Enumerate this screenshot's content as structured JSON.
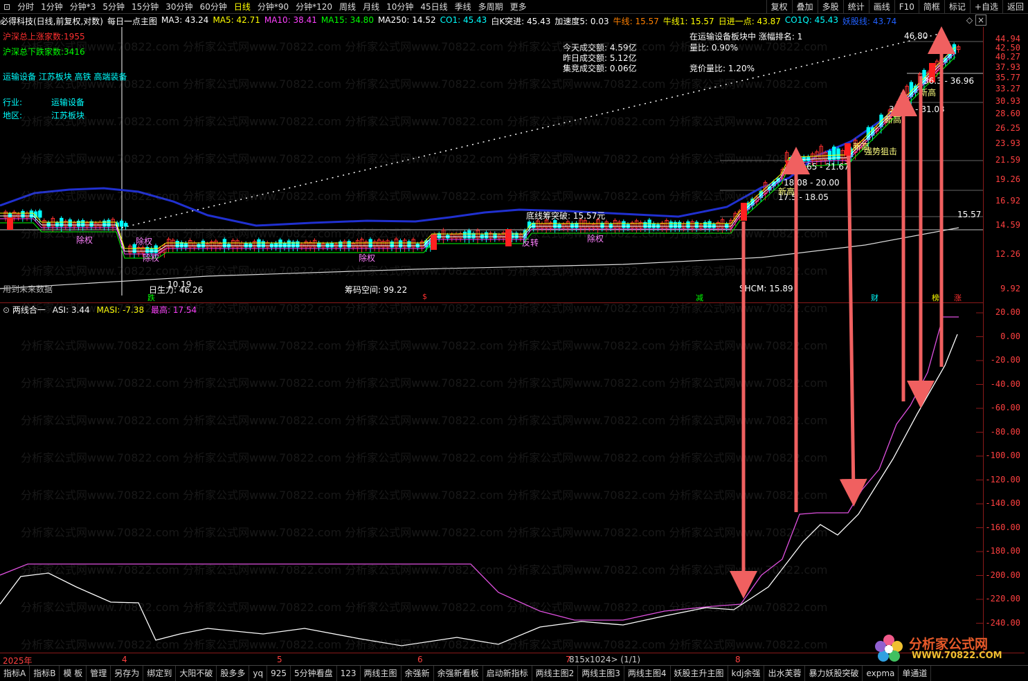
{
  "top_nav": {
    "periods": [
      "分时",
      "1分钟",
      "分钟*3",
      "5分钟",
      "15分钟",
      "30分钟",
      "60分钟",
      "日线",
      "分钟*90",
      "分钟*120",
      "周线",
      "月线",
      "10分钟",
      "45日线",
      "季线",
      "多周期",
      "更多"
    ],
    "active": "日线",
    "right_buttons": [
      "复权",
      "叠加",
      "多股",
      "统计",
      "画线",
      "F10",
      "简框",
      "标记",
      "+自选",
      "返回"
    ]
  },
  "stock": {
    "title": "必得科技(日线,前复权,对数)",
    "indicator_name": "每日一点主图",
    "ma_items": [
      {
        "label": "MA3: 43.24",
        "color": "#ffffff"
      },
      {
        "label": "MA5: 42.71",
        "color": "#ffff00"
      },
      {
        "label": "MA10: 38.41",
        "color": "#ff40ff"
      },
      {
        "label": "MA15: 34.80",
        "color": "#00ff00"
      },
      {
        "label": "MA250: 14.52",
        "color": "#ffffff"
      },
      {
        "label": "CO1: 45.43",
        "color": "#00ffff"
      },
      {
        "label": "白K突进: 45.43",
        "color": "#ffffff"
      },
      {
        "label": "加速度5: 0.03",
        "color": "#ffffff"
      },
      {
        "label": "牛线: 15.57",
        "color": "#ff8000"
      },
      {
        "label": "牛线1: 15.57",
        "color": "#ffff00"
      },
      {
        "label": "日进一点: 43.87",
        "color": "#ffff00"
      },
      {
        "label": "CO1Q: 45.43",
        "color": "#00ffff"
      },
      {
        "label": "妖股线: 43.74",
        "color": "#2060ff"
      }
    ]
  },
  "left_info": {
    "up_count": "沪深总上涨家数:1955",
    "down_count": "沪深总下跌家数:3416",
    "concepts": "运输设备  江苏板块  高铁  高端装备",
    "industry_label": "行业:",
    "industry_value": "运输设备",
    "region_label": "地区:",
    "region_value": "江苏板块",
    "future_data": "用到未来数据"
  },
  "center_info": {
    "today_amount": "今天成交额:  4.59亿",
    "yesterday_amount": "昨日成交额:  5.12亿",
    "auction_amount": "集竞成交额:  0.06亿",
    "sector_rank": "在运输设备板块中  涨幅排名:  1",
    "volume_ratio": "量比:  0.90%",
    "auction_ratio": "竞价量比:  1.20%"
  },
  "chart_labels": {
    "peak": "46.80",
    "low": "10.19",
    "breakout": "底线筹突破:  15.57元",
    "line_value": "15.57",
    "ret": "日生力:  46.26",
    "chip_space": "筹码空间:  99.22",
    "shcm": "SHCM:  15.89",
    "range1": "17.5  -  18.05",
    "range2": "18.08  -  20.00",
    "range3": "14.65  -  21.67",
    "range4": "30.15  -  31.03",
    "range5": "36.3  -  36.96",
    "new_high": "新高",
    "strong": "强势狙击",
    "fuquan": "除权",
    "fanzhuan": "反转",
    "badges": [
      "跌",
      "减",
      "财",
      "榜",
      "涨"
    ],
    "dollar": "$"
  },
  "main_axis": [
    "44.94",
    "42.50",
    "40.27",
    "37.93",
    "35.77",
    "33.27",
    "30.93",
    "28.60",
    "26.25",
    "23.93",
    "21.59",
    "19.26",
    "16.92",
    "14.59",
    "12.26",
    "9.92"
  ],
  "sub_panel": {
    "title": "两线合一",
    "asi": "ASI: 3.44",
    "masi": "MASI: -7.38",
    "high": "最高: 17.54",
    "axis": [
      "20.00",
      "0.00",
      "-20.00",
      "-40.00",
      "-60.00",
      "-80.00",
      "-100.00",
      "-120.00",
      "-140.00",
      "-160.00",
      "-180.00",
      "-200.00",
      "-220.00",
      "-240.00"
    ]
  },
  "dates": {
    "year": "2025年",
    "m4": "4",
    "m5": "5",
    "m6": "6",
    "m7": "7",
    "m8": "8",
    "center": "815x1024> (1/1)"
  },
  "bottom_tabs": [
    "指标A",
    "指标B",
    "模 板",
    "管理",
    "另存为",
    "绑定到",
    "大阳不破",
    "股多多",
    "yq",
    "925",
    "5分钟看盘",
    "123",
    "两线主图",
    "余强新",
    "余强新看板",
    "启动新指标",
    "两线主图2",
    "两线主图3",
    "两线主图4",
    "妖股主升主图",
    "kdj余强",
    "出水芙蓉",
    "暴力妖股突破",
    "expma",
    "单通道"
  ],
  "watermark": "分析家公式网www.70822.com",
  "logo": {
    "name": "分析家公式网",
    "url": "WWW.70822.COM"
  },
  "colors": {
    "up": "#ff3030",
    "down": "#00ffff",
    "grid": "#8b1a1a",
    "arrow": "#f06060",
    "ma": "#2040ff"
  }
}
